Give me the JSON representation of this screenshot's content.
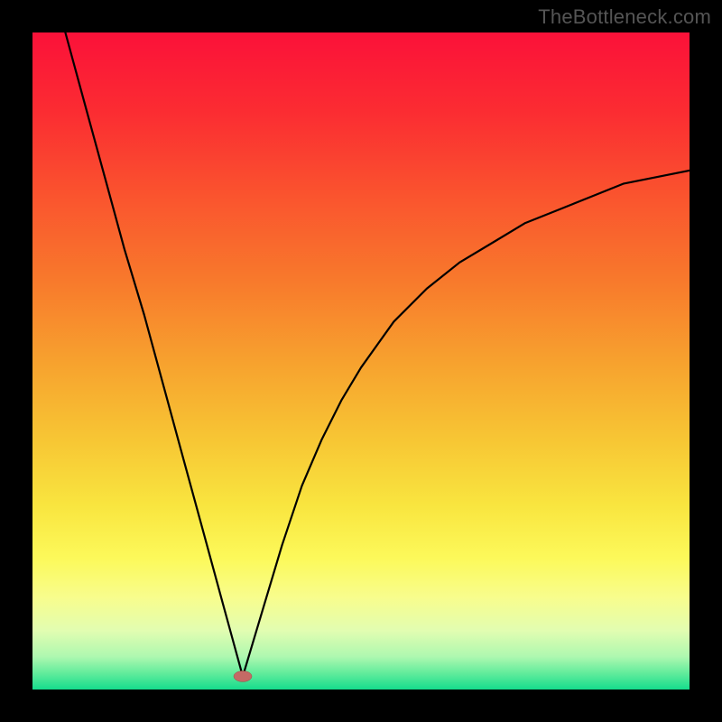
{
  "watermark": "TheBottleneck.com",
  "colors": {
    "frame": "#000000",
    "gradient_stops": [
      {
        "offset": 0.0,
        "color": "#fb1139"
      },
      {
        "offset": 0.12,
        "color": "#fb2c32"
      },
      {
        "offset": 0.25,
        "color": "#fa542e"
      },
      {
        "offset": 0.38,
        "color": "#f87a2c"
      },
      {
        "offset": 0.5,
        "color": "#f7a12e"
      },
      {
        "offset": 0.62,
        "color": "#f7c634"
      },
      {
        "offset": 0.72,
        "color": "#f9e53f"
      },
      {
        "offset": 0.8,
        "color": "#fcf95a"
      },
      {
        "offset": 0.86,
        "color": "#f8fd8d"
      },
      {
        "offset": 0.91,
        "color": "#e2fdb1"
      },
      {
        "offset": 0.95,
        "color": "#aef8b0"
      },
      {
        "offset": 0.975,
        "color": "#62ec9c"
      },
      {
        "offset": 1.0,
        "color": "#16dc8c"
      }
    ],
    "curve": "#000000",
    "min_marker": "#c46a65"
  },
  "chart_data": {
    "type": "line",
    "title": "",
    "xlabel": "",
    "ylabel": "",
    "xlim": [
      0,
      100
    ],
    "ylim": [
      0,
      100
    ],
    "min_point": {
      "x": 32,
      "y": 2
    },
    "series": [
      {
        "name": "bottleneck-curve",
        "x": [
          5,
          8,
          11,
          14,
          17,
          20,
          23,
          26,
          29,
          32,
          35,
          38,
          41,
          44,
          47,
          50,
          55,
          60,
          65,
          70,
          75,
          80,
          85,
          90,
          95,
          100
        ],
        "y": [
          100,
          89,
          78,
          67,
          57,
          46,
          35,
          24,
          13,
          2,
          12,
          22,
          31,
          38,
          44,
          49,
          56,
          61,
          65,
          68,
          71,
          73,
          75,
          77,
          78,
          79
        ]
      }
    ],
    "legend": false,
    "grid": false
  }
}
